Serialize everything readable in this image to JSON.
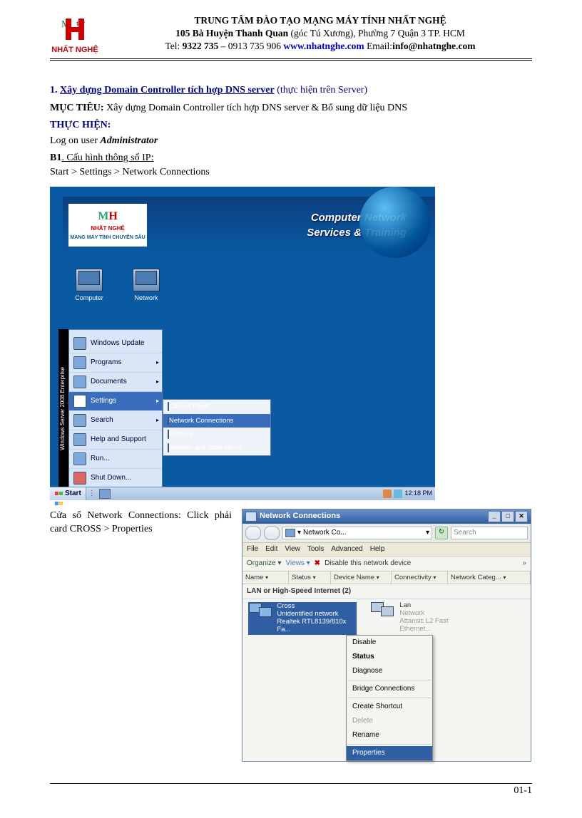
{
  "header": {
    "logo_label": "NHẤT NGHỆ",
    "line1": "TRUNG TÂM ĐÀO TẠO MẠNG MÁY TÍNH NHẤT NGHỆ",
    "line2a": "105 Bà Huyện Thanh Quan",
    "line2b": " (góc Tú Xương), Phường 7 Quận 3  TP. HCM",
    "line3a": "Tel: ",
    "line3_phone": "9322 735",
    "line3b": " – 0913 735 906    ",
    "website": "www.nhatnghe.com",
    "line3c": "     Email:",
    "email": "info@nhatnghe.com"
  },
  "content": {
    "sec1_num": "1. ",
    "sec1_title": "Xây dựng Domain Controller tích hợp DNS server",
    "sec1_tail": " (thực hiện trên Server)",
    "goal_label": "MỤC TIÊU:",
    "goal_text": " Xây dựng Domain Controller tích hợp DNS server & Bổ sung dữ liệu DNS",
    "do_label": "THỰC HIỆN:",
    "logon_a": "Log on user ",
    "logon_b": "Administrator",
    "b1_label": "B1",
    "b1_title": ". Cấu hình thông số IP:",
    "b1_path": "Start > Settings > Network Connections",
    "row2_text": "Cửa sổ Network Connections: Click phải card CROSS > Properties"
  },
  "desktop": {
    "banner_logo": "NHẤT NGHỆ",
    "banner_sub": "MẠNG MÁY TÍNH CHUYÊN SÂU",
    "banner_r1": "Computer Network",
    "banner_r2": "Services & Training",
    "icon1": "Computer",
    "icon2": "Network",
    "ws_strip": "Windows Server 2008 Enterprise",
    "menu": {
      "wu": "Windows Update",
      "programs": "Programs",
      "documents": "Documents",
      "settings": "Settings",
      "search": "Search",
      "help": "Help and Support",
      "run": "Run...",
      "shutdown": "Shut Down..."
    },
    "submenu": {
      "cp": "Control Panel",
      "nc": "Network Connections",
      "printers": "Printers",
      "tsb": "Taskbar and Start Menu"
    },
    "taskbar": {
      "start": "Start",
      "clock": "12:18 PM"
    }
  },
  "nc": {
    "title": "Network Connections",
    "addr": "Network Co...",
    "search": "Search",
    "menus": [
      "File",
      "Edit",
      "View",
      "Tools",
      "Advanced",
      "Help"
    ],
    "toolbar": {
      "organize": "Organize ▾",
      "views": "Views ▾",
      "disable": "Disable this network device",
      "more": "»"
    },
    "cols": {
      "name": "Name",
      "status": "Status",
      "device": "Device Name",
      "conn": "Connectivity",
      "cat": "Network Categ..."
    },
    "group": "LAN or High-Speed Internet (2)",
    "card1": {
      "name": "Cross",
      "status": "Unidentified network",
      "dev": "Realtek RTL8139/810x Fa..."
    },
    "card2": {
      "name": "Lan",
      "status": "Network",
      "dev": "Attansic L2 Fast Ethernet..."
    },
    "ctx": {
      "disable": "Disable",
      "status": "Status",
      "diagnose": "Diagnose",
      "bridge": "Bridge Connections",
      "shortcut": "Create Shortcut",
      "delete": "Delete",
      "rename": "Rename",
      "properties": "Properties"
    }
  },
  "footer": {
    "pagenum": "01-1"
  }
}
